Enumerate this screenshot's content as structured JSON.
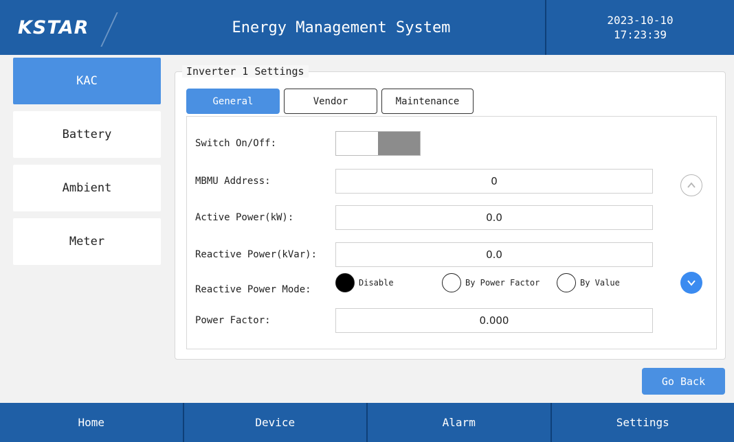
{
  "header": {
    "logo": "KSTAR",
    "title": "Energy Management System",
    "date": "2023-10-10",
    "time": "17:23:39"
  },
  "sidebar": {
    "items": [
      {
        "label": "KAC",
        "active": true
      },
      {
        "label": "Battery",
        "active": false
      },
      {
        "label": "Ambient",
        "active": false
      },
      {
        "label": "Meter",
        "active": false
      }
    ]
  },
  "group": {
    "title": "Inverter 1 Settings",
    "tabs": [
      {
        "label": "General",
        "active": true
      },
      {
        "label": "Vendor",
        "active": false
      },
      {
        "label": "Maintenance",
        "active": false
      }
    ]
  },
  "form": {
    "switch": {
      "label": "Switch On/Off:",
      "state": "on"
    },
    "mbmu_address": {
      "label": "MBMU Address:",
      "value": "0"
    },
    "active_power": {
      "label": "Active Power(kW):",
      "value": "0.0"
    },
    "reactive_power": {
      "label": "Reactive Power(kVar):",
      "value": "0.0"
    },
    "reactive_mode": {
      "label": "Reactive Power Mode:",
      "options": [
        "Disable",
        "By Power Factor",
        "By Value"
      ],
      "selected": "Disable"
    },
    "power_factor": {
      "label": "Power Factor:",
      "value": "0.000"
    }
  },
  "actions": {
    "go_back": "Go Back"
  },
  "footer": {
    "items": [
      "Home",
      "Device",
      "Alarm",
      "Settings"
    ]
  },
  "colors": {
    "header_bg": "#1f5fa6",
    "accent": "#4a90e2",
    "scroll_down": "#3b8bf0"
  },
  "icons": {
    "scroll_up": "chevron-up-icon",
    "scroll_down": "chevron-down-icon"
  }
}
